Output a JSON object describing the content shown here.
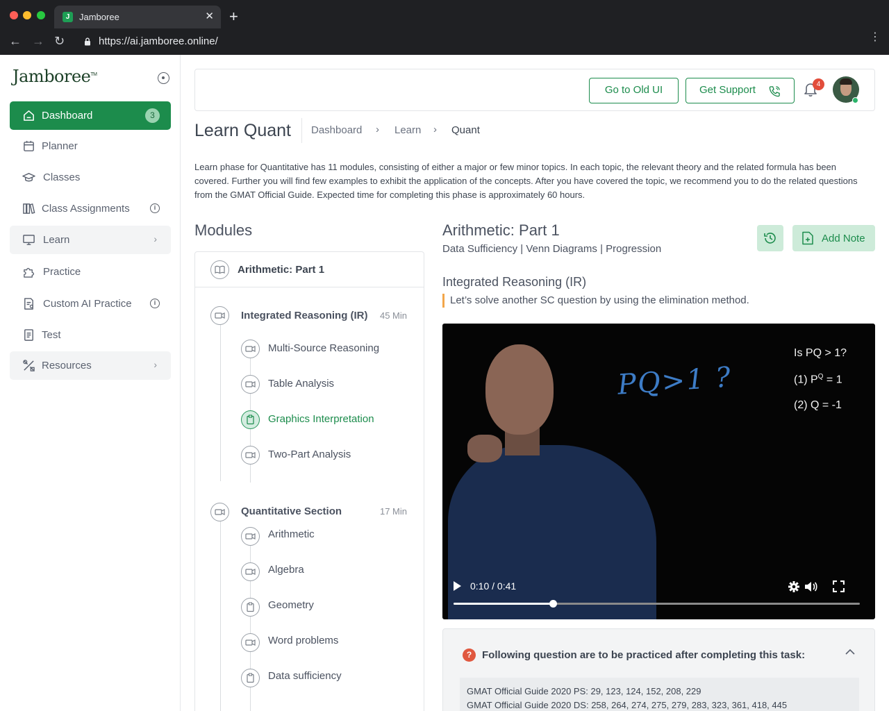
{
  "browser": {
    "tab_title": "Jamboree",
    "tab_favicon": "J",
    "url": "https://ai.jamboree.online/"
  },
  "colors": {
    "accent": "#1c8c4c",
    "accent_light": "#cdebd9",
    "badge_red": "#e24d3b",
    "quote_bar": "#f2a64a"
  },
  "sidebar": {
    "logo": "Jamboree",
    "logo_tm": "TM",
    "items": [
      {
        "label": "Dashboard",
        "icon": "home-icon",
        "badge": "3"
      },
      {
        "label": "Planner",
        "icon": "calendar-icon"
      },
      {
        "label": "Classes",
        "icon": "graduation-cap-icon"
      },
      {
        "label": "Class Assignments",
        "icon": "books-icon",
        "info": "i"
      },
      {
        "label": "Learn",
        "icon": "monitor-icon",
        "chevron": "›"
      },
      {
        "label": "Practice",
        "icon": "puzzle-icon"
      },
      {
        "label": "Custom AI Practice",
        "icon": "ai-document-icon",
        "info": "i"
      },
      {
        "label": "Test",
        "icon": "document-icon"
      },
      {
        "label": "Resources",
        "icon": "tools-icon",
        "chevron": "›"
      }
    ]
  },
  "header": {
    "old_ui_label": "Go to Old UI",
    "support_label": "Get Support",
    "notification_count": "4"
  },
  "page": {
    "title": "Learn Quant",
    "breadcrumb": [
      "Dashboard",
      "Learn",
      "Quant"
    ],
    "breadcrumb_sep": "›",
    "description": "Learn phase for Quantitative has 11 modules, consisting of either a major or few minor topics. In each topic, the relevant theory and the related formula has been covered. Further you will find few examples to exhibit the application of the concepts. After you have covered the topic, we recommend you to do the related questions from the GMAT Official Guide. Expected time for completing this phase is approximately 60 hours."
  },
  "modules": {
    "heading": "Modules",
    "current_module": "Arithmetic: Part 1",
    "sections": [
      {
        "title": "Integrated Reasoning (IR)",
        "time": "45 Min",
        "items": [
          {
            "label": "Multi-Source Reasoning",
            "type": "video"
          },
          {
            "label": "Table Analysis",
            "type": "video"
          },
          {
            "label": "Graphics Interpretation",
            "type": "clipboard",
            "active": true
          },
          {
            "label": "Two-Part Analysis",
            "type": "video"
          }
        ]
      },
      {
        "title": "Quantitative Section",
        "time": "17 Min",
        "items": [
          {
            "label": "Arithmetic",
            "type": "video"
          },
          {
            "label": "Algebra",
            "type": "video"
          },
          {
            "label": "Geometry",
            "type": "clipboard"
          },
          {
            "label": "Word problems",
            "type": "video"
          },
          {
            "label": "Data sufficiency",
            "type": "clipboard"
          }
        ]
      }
    ]
  },
  "content": {
    "title": "Arithmetic: Part 1",
    "subtitle": "Data Sufficiency | Venn Diagrams | Progression",
    "add_note_label": "Add Note",
    "section_title": "Integrated Reasoning (IR)",
    "quote": "Let’s solve another SC question by using the elimination method."
  },
  "video": {
    "board_lines": [
      "Is PQ > 1?",
      "(1) P",
      "Q",
      " = 1",
      "(2) Q = -1"
    ],
    "handwriting": "PQ>1 ?",
    "time": "0:10 / 0:41",
    "progress": 0.244
  },
  "practice": {
    "icon_text": "?",
    "title": "Following question are to be practiced after completing this task:",
    "lines": [
      "GMAT Official Guide 2020 PS: 29, 123, 124, 152, 208, 229",
      "GMAT Official Guide 2020 DS: 258, 264, 274, 275, 279, 283, 323, 361, 418, 445"
    ]
  }
}
